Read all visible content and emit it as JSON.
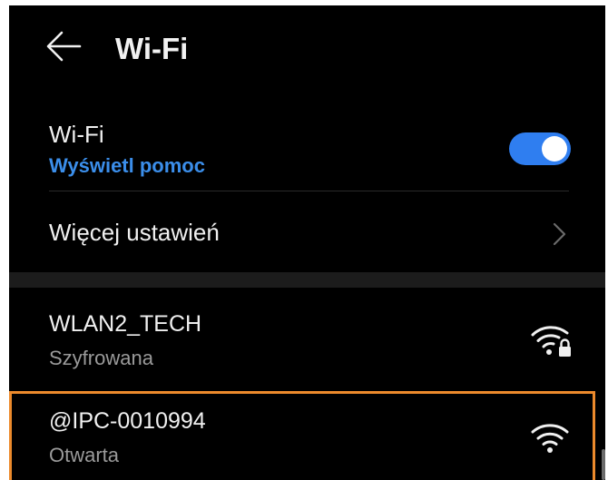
{
  "header": {
    "title": "Wi-Fi",
    "back_icon": "arrow-left-icon"
  },
  "wifi_toggle": {
    "label": "Wi-Fi",
    "help_link": "Wyświetl pomoc",
    "enabled": true,
    "accent_color": "#2f7ef0"
  },
  "more_settings": {
    "label": "Więcej ustawień",
    "icon": "chevron-right-icon"
  },
  "networks": [
    {
      "name": "WLAN2_TECH",
      "status": "Szyfrowana",
      "icon": "wifi-locked-icon"
    },
    {
      "name": "@IPC-0010994",
      "status": "Otwarta",
      "icon": "wifi-icon"
    }
  ],
  "colors": {
    "background": "#000000",
    "highlight": "#ec8a2c",
    "link": "#3b8eea"
  }
}
